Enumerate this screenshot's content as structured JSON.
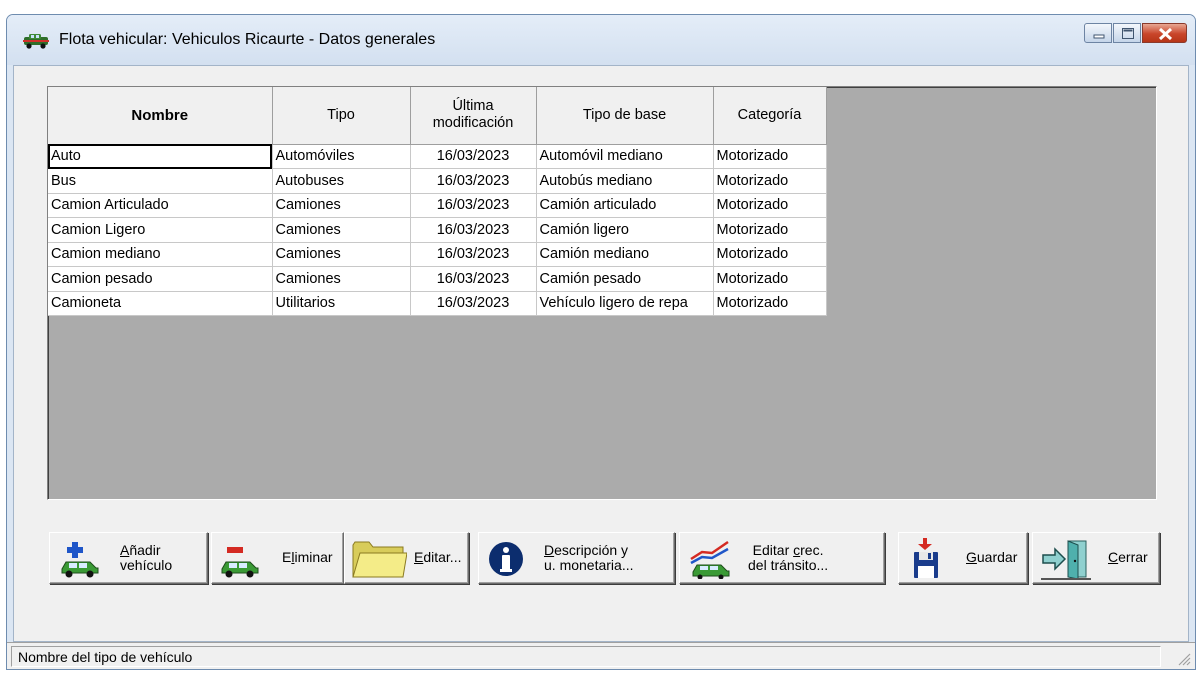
{
  "window": {
    "title": "Flota vehicular: Vehiculos Ricaurte - Datos generales",
    "icon": "car-app-icon",
    "controls": [
      "minimize",
      "maximize",
      "close"
    ]
  },
  "table": {
    "headers": {
      "nombre": "Nombre",
      "tipo": "Tipo",
      "ultima_line1": "Última",
      "ultima_line2": "modificación",
      "tipo_base": "Tipo de base",
      "categoria": "Categoría"
    },
    "rows": [
      {
        "nombre": "Auto",
        "tipo": "Automóviles",
        "fecha": "16/03/2023",
        "base": "Automóvil mediano",
        "categoria": "Motorizado"
      },
      {
        "nombre": "Bus",
        "tipo": "Autobuses",
        "fecha": "16/03/2023",
        "base": "Autobús mediano",
        "categoria": "Motorizado"
      },
      {
        "nombre": "Camion Articulado",
        "tipo": "Camiones",
        "fecha": "16/03/2023",
        "base": "Camión articulado",
        "categoria": "Motorizado"
      },
      {
        "nombre": "Camion Ligero",
        "tipo": "Camiones",
        "fecha": "16/03/2023",
        "base": "Camión ligero",
        "categoria": "Motorizado"
      },
      {
        "nombre": "Camion mediano",
        "tipo": "Camiones",
        "fecha": "16/03/2023",
        "base": "Camión mediano",
        "categoria": "Motorizado"
      },
      {
        "nombre": "Camion pesado",
        "tipo": "Camiones",
        "fecha": "16/03/2023",
        "base": "Camión pesado",
        "categoria": "Motorizado"
      },
      {
        "nombre": "Camioneta",
        "tipo": "Utilitarios",
        "fecha": "16/03/2023",
        "base": "Vehículo ligero de repa",
        "categoria": "Motorizado"
      }
    ]
  },
  "buttons": {
    "anadir": {
      "pre": "",
      "key": "A",
      "post": "ñadir",
      "line2": "vehículo"
    },
    "eliminar": {
      "pre": "E",
      "key": "l",
      "post": "iminar"
    },
    "editar": {
      "pre": "",
      "key": "E",
      "post": "ditar..."
    },
    "descripcion": {
      "pre": "",
      "key": "D",
      "post": "escripción y",
      "line2": "u. monetaria..."
    },
    "crec": {
      "pre": "Editar ",
      "key": "c",
      "post": "rec.",
      "line2": "del tránsito..."
    },
    "guardar": {
      "pre": "",
      "key": "G",
      "post": "uardar"
    },
    "cerrar": {
      "pre": "",
      "key": "C",
      "post": "errar"
    }
  },
  "status": {
    "text": "Nombre del tipo de vehículo"
  },
  "colors": {
    "grid_background": "#ababab",
    "header_background": "#f0f0f0",
    "close_button": "#c9452a"
  }
}
